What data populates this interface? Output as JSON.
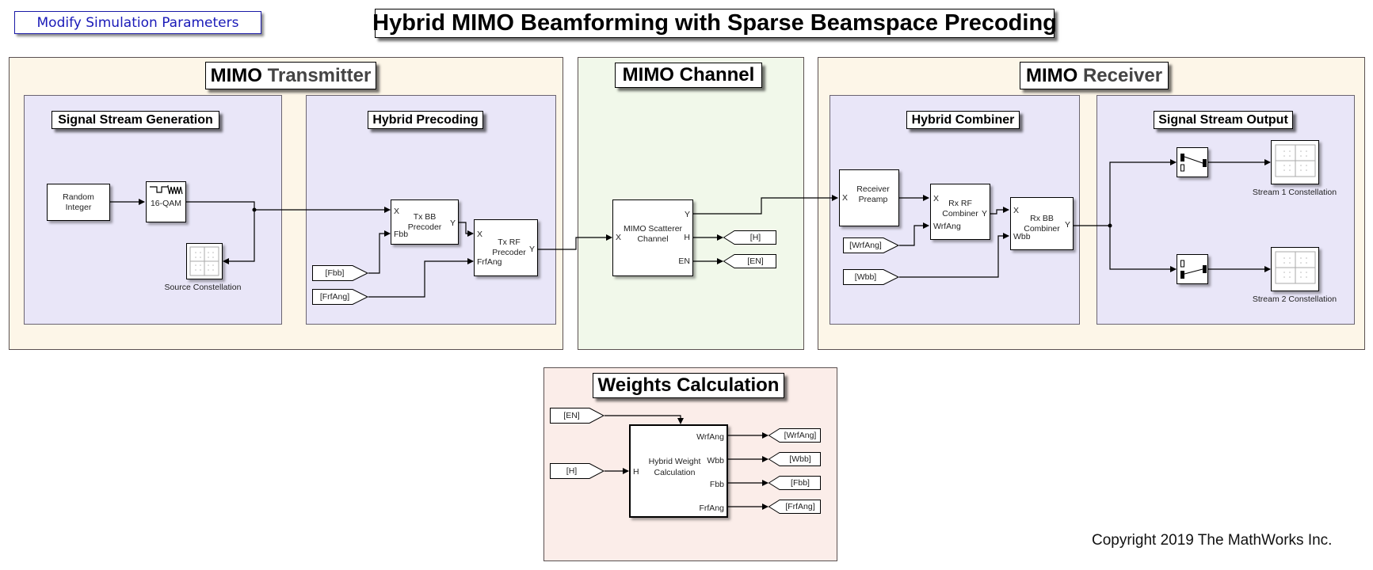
{
  "header": {
    "title": "Hybrid MIMO Beamforming with Sparse Beamspace Precoding",
    "params_link": "Modify Simulation Parameters"
  },
  "areas": {
    "transmitter": {
      "bold": "MIMO",
      "rest": "Transmitter"
    },
    "channel": {
      "title": "MIMO Channel"
    },
    "receiver": {
      "bold": "MIMO",
      "rest": "Receiver"
    },
    "weights": {
      "title": "Weights Calculation"
    }
  },
  "subareas": {
    "signal_gen": "Signal Stream Generation",
    "hybrid_precoding": "Hybrid Precoding",
    "hybrid_combiner": "Hybrid Combiner",
    "signal_out": "Signal Stream Output"
  },
  "blocks": {
    "random_integer": {
      "line1": "Random",
      "line2": "Integer"
    },
    "qam": {
      "label": "16-QAM"
    },
    "source_constellation": {
      "label": "Source Constellation"
    },
    "tx_bb": {
      "line1": "Tx BB",
      "line2": "Precoder",
      "in1": "X",
      "in2": "Fbb",
      "out": "Y"
    },
    "tx_rf": {
      "line1": "Tx RF",
      "line2": "Precoder",
      "in1": "X",
      "in2": "FrfAng",
      "out": "Y"
    },
    "channel": {
      "line1": "MIMO Scatterer",
      "line2": "Channel",
      "in": "X",
      "out1": "Y",
      "out2": "H",
      "out3": "EN"
    },
    "preamp": {
      "line1": "Receiver",
      "line2": "Preamp",
      "in": "X"
    },
    "rx_rf": {
      "line1": "Rx RF",
      "line2": "Combiner",
      "in1": "X",
      "in2": "WrfAng",
      "out": "Y"
    },
    "rx_bb": {
      "line1": "Rx BB",
      "line2": "Combiner",
      "in1": "X",
      "in2": "Wbb",
      "out": "Y"
    },
    "stream1": {
      "label": "Stream 1 Constellation"
    },
    "stream2": {
      "label": "Stream 2 Constellation"
    },
    "hybrid_weight": {
      "line1": "Hybrid Weight",
      "line2": "Calculation",
      "in": "H",
      "out1": "WrfAng",
      "out2": "Wbb",
      "out3": "Fbb",
      "out4": "FrfAng"
    }
  },
  "tags": {
    "fbb_from": "[Fbb]",
    "frfang_from": "[FrfAng]",
    "h_goto": "[H]",
    "en_goto": "[EN]",
    "wrfang_from": "[WrfAng]",
    "wbb_from": "[Wbb]",
    "en_from": "[EN]",
    "h_from": "[H]",
    "wrfang_goto": "[WrfAng]",
    "wbb_goto": "[Wbb]",
    "fbb_goto": "[Fbb]",
    "frfang_goto": "[FrfAng]"
  },
  "footer": {
    "copyright": "Copyright 2019 The MathWorks Inc."
  }
}
